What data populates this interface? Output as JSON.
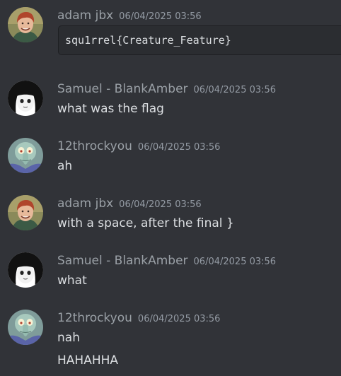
{
  "messages": [
    {
      "author": "adam jbx",
      "timestamp": "06/04/2025 03:56",
      "avatar_icon": "person-face-avatar-icon",
      "code": "squ1rrel{Creature_Feature}"
    },
    {
      "author": "Samuel - BlankAmber",
      "timestamp": "06/04/2025 03:56",
      "avatar_icon": "anime-girl-avatar-icon",
      "lines": [
        "what was the flag"
      ]
    },
    {
      "author": "12throckyou",
      "timestamp": "06/04/2025 03:56",
      "avatar_icon": "squidward-avatar-icon",
      "lines": [
        "ah"
      ]
    },
    {
      "author": "adam jbx",
      "timestamp": "06/04/2025 03:56",
      "avatar_icon": "person-face-avatar-icon",
      "lines": [
        "with a space, after the final }"
      ]
    },
    {
      "author": "Samuel - BlankAmber",
      "timestamp": "06/04/2025 03:56",
      "avatar_icon": "anime-girl-avatar-icon",
      "lines": [
        "what"
      ]
    },
    {
      "author": "12throckyou",
      "timestamp": "06/04/2025 03:56",
      "avatar_icon": "squidward-avatar-icon",
      "lines": [
        "nah",
        "HAHAHHA"
      ]
    }
  ],
  "colors": {
    "background": "#313338",
    "author": "#9aa0a6",
    "timestamp": "#949ba4",
    "text": "#dbdee1",
    "codeblock_bg": "#2b2d31"
  }
}
